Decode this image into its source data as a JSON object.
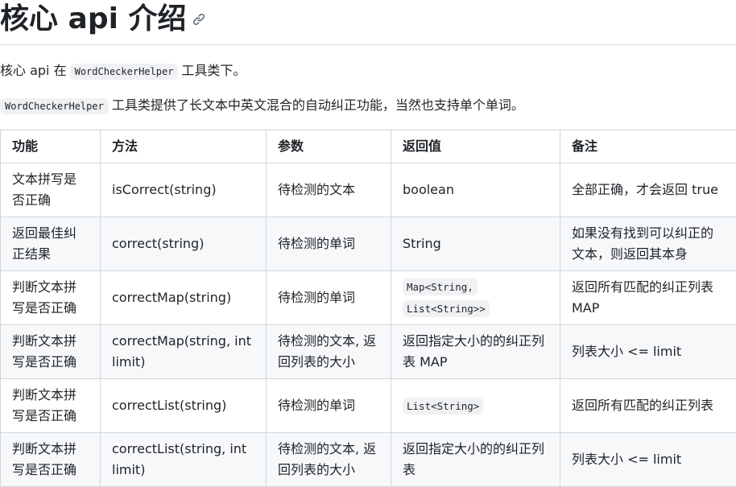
{
  "heading": {
    "title": "核心 api 介绍",
    "anchor_icon": "link-icon"
  },
  "intro": {
    "p1_before": "核心 api 在",
    "p1_code": "WordCheckerHelper",
    "p1_after": "工具类下。",
    "p2_code": "WordCheckerHelper",
    "p2_after": "工具类提供了长文本中英文混合的自动纠正功能，当然也支持单个单词。"
  },
  "table": {
    "headers": [
      "功能",
      "方法",
      "参数",
      "返回值",
      "备注"
    ],
    "rows": [
      {
        "feature": "文本拼写是否正确",
        "method": "isCorrect(string)",
        "param": "待检测的文本",
        "return": "boolean",
        "return_is_code": false,
        "note": "全部正确，才会返回 true"
      },
      {
        "feature": "返回最佳纠正结果",
        "method": "correct(string)",
        "param": "待检测的单词",
        "return": "String",
        "return_is_code": false,
        "note": "如果没有找到可以纠正的文本，则返回其本身"
      },
      {
        "feature": "判断文本拼写是否正确",
        "method": "correctMap(string)",
        "param": "待检测的单词",
        "return_code_1": "Map<String,",
        "return_code_2": "List<String>>",
        "return_is_code": true,
        "note": "返回所有匹配的纠正列表 MAP"
      },
      {
        "feature": "判断文本拼写是否正确",
        "method": "correctMap(string, int limit)",
        "param": "待检测的文本, 返回列表的大小",
        "return": "返回指定大小的的纠正列表 MAP",
        "return_is_code": false,
        "note": "列表大小 <= limit"
      },
      {
        "feature": "判断文本拼写是否正确",
        "method": "correctList(string)",
        "param": "待检测的单词",
        "return_code_1": "List<String>",
        "return_is_code": true,
        "note": "返回所有匹配的纠正列表"
      },
      {
        "feature": "判断文本拼写是否正确",
        "method": "correctList(string, int limit)",
        "param": "待检测的文本, 返回列表的大小",
        "return": "返回指定大小的的纠正列表",
        "return_is_code": false,
        "note": "列表大小 <= limit"
      }
    ]
  }
}
